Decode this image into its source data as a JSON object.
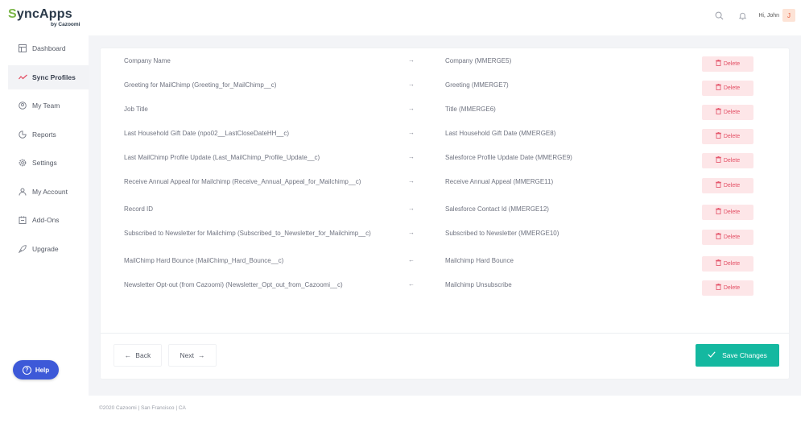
{
  "brand": {
    "name_s": "S",
    "name_rest": "yncApps",
    "sub": "by Cazoomi"
  },
  "header": {
    "greeting": "Hi, John",
    "avatar_initial": "J"
  },
  "sidebar": {
    "items": [
      {
        "label": "Dashboard",
        "icon": "dashboard-icon"
      },
      {
        "label": "Sync Profiles",
        "icon": "sync-profiles-icon",
        "active": true
      },
      {
        "label": "My Team",
        "icon": "team-icon"
      },
      {
        "label": "Reports",
        "icon": "reports-icon"
      },
      {
        "label": "Settings",
        "icon": "gear-icon"
      },
      {
        "label": "My Account",
        "icon": "user-icon"
      },
      {
        "label": "Add-Ons",
        "icon": "addons-icon"
      },
      {
        "label": "Upgrade",
        "icon": "rocket-icon"
      }
    ],
    "help_label": "Help"
  },
  "mappings": [
    {
      "source": "Company Name",
      "direction": "→",
      "target": "Company (MMERGE5)",
      "action": "Delete"
    },
    {
      "source": "Greeting for MailChimp (Greeting_for_MailChimp__c)",
      "direction": "→",
      "target": "Greeting (MMERGE7)",
      "action": "Delete"
    },
    {
      "source": "Job Title",
      "direction": "→",
      "target": "Title (MMERGE6)",
      "action": "Delete"
    },
    {
      "source": "Last Household Gift Date (npo02__LastCloseDateHH__c)",
      "direction": "→",
      "target": "Last Household Gift Date (MMERGE8)",
      "action": "Delete"
    },
    {
      "source": "Last MailChimp Profile Update (Last_MailChimp_Profile_Update__c)",
      "direction": "→",
      "target": "Salesforce Profile Update Date (MMERGE9)",
      "action": "Delete"
    },
    {
      "source": "Receive Annual Appeal for Mailchimp (Receive_Annual_Appeal_for_Mailchimp__c)",
      "direction": "→",
      "target": "Receive Annual Appeal (MMERGE11)",
      "action": "Delete"
    },
    {
      "source": "Record ID",
      "direction": "→",
      "target": "Salesforce Contact Id (MMERGE12)",
      "action": "Delete"
    },
    {
      "source": "Subscribed to Newsletter for Mailchimp (Subscribed_to_Newsletter_for_Mailchimp__c)",
      "direction": "→",
      "target": "Subscribed to Newsletter (MMERGE10)",
      "action": "Delete"
    },
    {
      "source": "MailChimp Hard Bounce (MailChimp_Hard_Bounce__c)",
      "direction": "←",
      "target": "Mailchimp Hard Bounce",
      "action": "Delete"
    },
    {
      "source": "Newsletter Opt-out (from Cazoomi) (Newsletter_Opt_out_from_Cazoomi__c)",
      "direction": "←",
      "target": "Mailchimp Unsubscribe",
      "action": "Delete"
    }
  ],
  "footer": {
    "back_label": "Back",
    "next_label": "Next",
    "save_label": "Save Changes"
  },
  "copyright": "©2020 Cazoomi | San Francisco | CA",
  "colors": {
    "accent": "#14b8a0",
    "help": "#3d59d8",
    "delete_text": "#e34d63",
    "delete_bg": "#fde6e8"
  }
}
